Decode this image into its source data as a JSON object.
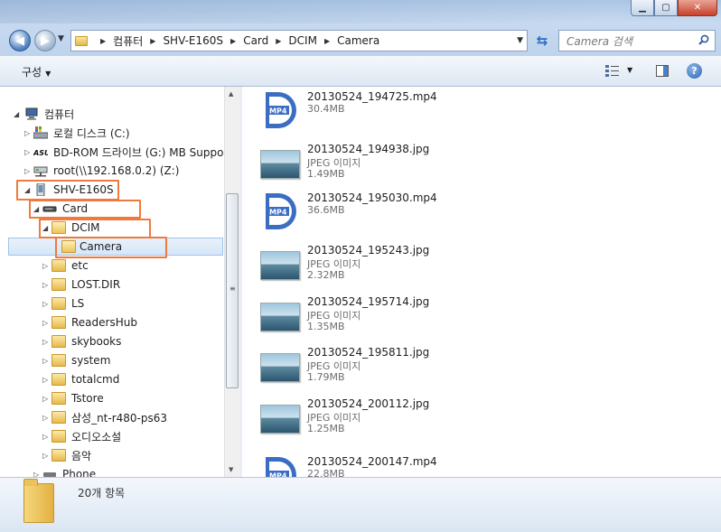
{
  "window": {
    "minimize_icon": "minimize-icon",
    "maximize_icon": "maximize-icon",
    "close_icon": "close-icon"
  },
  "address": {
    "crumbs": [
      "컴퓨터",
      "SHV-E160S",
      "Card",
      "DCIM",
      "Camera"
    ],
    "search_placeholder": "Camera 검색"
  },
  "toolbar": {
    "organize_label": "구성",
    "help_label": "?"
  },
  "nav": {
    "items": [
      {
        "label": "컴퓨터",
        "icon": "computer-icon"
      },
      {
        "label": "로컬 디스크 (C:)",
        "icon": "hard-drive-icon"
      },
      {
        "label": "BD-ROM 드라이브 (G:) MB Support",
        "icon": "bd-rom-icon"
      },
      {
        "label": "root(\\\\192.168.0.2) (Z:)",
        "icon": "network-drive-icon"
      },
      {
        "label": "SHV-E160S",
        "icon": "phone-icon"
      },
      {
        "label": "Card",
        "icon": "card-icon"
      },
      {
        "label": "DCIM",
        "icon": "folder-icon"
      },
      {
        "label": "Camera",
        "icon": "folder-icon"
      },
      {
        "label": "etc",
        "icon": "folder-icon"
      },
      {
        "label": "LOST.DIR",
        "icon": "folder-icon"
      },
      {
        "label": "LS",
        "icon": "folder-icon"
      },
      {
        "label": "ReadersHub",
        "icon": "folder-icon"
      },
      {
        "label": "skybooks",
        "icon": "folder-icon"
      },
      {
        "label": "system",
        "icon": "folder-icon"
      },
      {
        "label": "totalcmd",
        "icon": "folder-icon"
      },
      {
        "label": "Tstore",
        "icon": "folder-icon"
      },
      {
        "label": "삼성_nt-r480-ps63",
        "icon": "folder-icon"
      },
      {
        "label": "오디오소설",
        "icon": "folder-icon"
      },
      {
        "label": "음악",
        "icon": "folder-icon"
      },
      {
        "label": "Phone",
        "icon": "phone-storage-icon"
      }
    ]
  },
  "files": [
    {
      "name": "20130524_194725.mp4",
      "type": "",
      "size": "30.4MB",
      "kind": "mp4"
    },
    {
      "name": "20130524_194938.jpg",
      "type": "JPEG 이미지",
      "size": "1.49MB",
      "kind": "jpg"
    },
    {
      "name": "20130524_195030.mp4",
      "type": "",
      "size": "36.6MB",
      "kind": "mp4"
    },
    {
      "name": "20130524_195243.jpg",
      "type": "JPEG 이미지",
      "size": "2.32MB",
      "kind": "jpg"
    },
    {
      "name": "20130524_195714.jpg",
      "type": "JPEG 이미지",
      "size": "1.35MB",
      "kind": "jpg"
    },
    {
      "name": "20130524_195811.jpg",
      "type": "JPEG 이미지",
      "size": "1.79MB",
      "kind": "jpg"
    },
    {
      "name": "20130524_200112.jpg",
      "type": "JPEG 이미지",
      "size": "1.25MB",
      "kind": "jpg"
    },
    {
      "name": "20130524_200147.mp4",
      "type": "",
      "size": "22.8MB",
      "kind": "mp4"
    }
  ],
  "status": {
    "item_count": "20개 항목"
  },
  "colors": {
    "highlight": "#f07a3b",
    "selection": "#d7e6f7",
    "mp4_accent": "#3b6ec2"
  }
}
